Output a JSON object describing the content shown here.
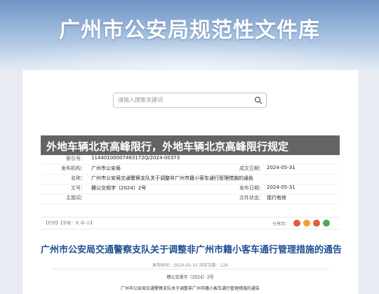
{
  "banner": {
    "title": "广州市公安局规范性文件库"
  },
  "search": {
    "placeholder": "请输入搜索关键词"
  },
  "overlay": {
    "text": "外地车辆北京高峰限行，外地车辆北京高峰限行规定"
  },
  "meta": {
    "index_label": "索引号：",
    "index_value": "11440100007483172Q/2024-00373",
    "issuer_label": "发布机构：",
    "issuer_value": "广州市公安局",
    "date_label": "成文日期：",
    "date_value": "2024-05-31",
    "name_label": "名称：",
    "name_value": "广州市公安局交通警察支队关于调整非广州市籍小客车通行管理措施的通告",
    "docnum_label": "文号：",
    "docnum_value": "穗公交规字〔2024〕2号",
    "pubdate_label": "发布日期：",
    "pubdate_value": "2024-05-31",
    "topic_label": "主题词：",
    "topic_value": "",
    "validity_label": "文件状态：",
    "validity_value": "现行有效"
  },
  "tools": {
    "font_size": "【打印】【字体：大 中 小】",
    "share": "分享到："
  },
  "document": {
    "title": "广州市公安局交通警察支队关于调整非广州市籍小客车通行管理措施的通告",
    "subline": "发布时间：2024-05-31  浏览次数：126",
    "number": "穗公交规字〔2024〕2号",
    "name_line": "广州市公安局交通警察支队关于调整非广州市籍小客车通行管理措施的通告"
  },
  "colors": {
    "title_blue": "#1f4f93",
    "banner_top": "#6f94c4"
  }
}
